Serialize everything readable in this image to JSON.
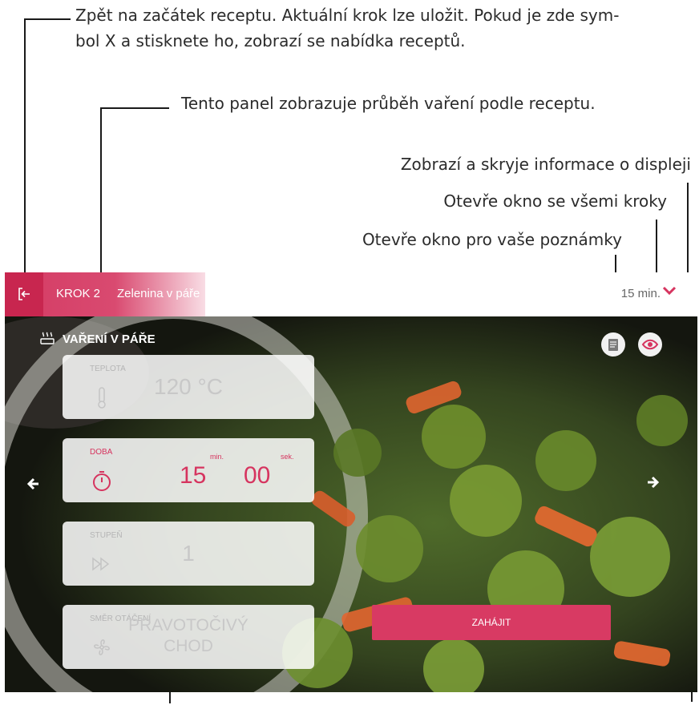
{
  "annotations": {
    "back_line1": "Zpět na začátek receptu. Aktuální krok lze uložit. Pokud je zde sym-",
    "back_line2": "bol X a stisknete ho, zobrazí se nabídka receptů.",
    "panel": "Tento panel zobrazuje průběh vaření podle receptu.",
    "display_info": "Zobrazí a skryje informace o displeji",
    "steps_window": "Otevře okno se všemi kroky",
    "notes_window": "Otevře okno pro vaše poznámky"
  },
  "header": {
    "step_label": "KROK 2",
    "step_title": "Zelenina v páře",
    "time": "15 min.",
    "exit_icon": "exit-icon",
    "expand_icon": "chevron-down-icon"
  },
  "program": {
    "title": "VAŘENÍ V PÁŘE",
    "icon": "steam-icon"
  },
  "params": {
    "temperature": {
      "label": "TEPLOTA",
      "value": "120 °C",
      "icon": "thermometer-icon"
    },
    "duration": {
      "label": "DOBA",
      "minutes": "15",
      "seconds": "00",
      "min_unit": "min.",
      "sec_unit": "sek.",
      "icon": "timer-icon"
    },
    "level": {
      "label": "STUPEŇ",
      "value": "1",
      "icon": "fast-forward-icon"
    },
    "rotation": {
      "label": "SMĚR OTÁČENÍ",
      "value_line1": "PRAVOTOČIVÝ",
      "value_line2": "CHOD",
      "icon": "fan-icon"
    }
  },
  "actions": {
    "start": "ZAHÁJIT",
    "notes_icon": "notes-icon",
    "info_icon": "eye-icon",
    "prev_icon": "arrow-left-icon",
    "next_icon": "arrow-right-icon"
  },
  "colors": {
    "accent": "#d83a63",
    "accent_dark": "#c8264f"
  }
}
